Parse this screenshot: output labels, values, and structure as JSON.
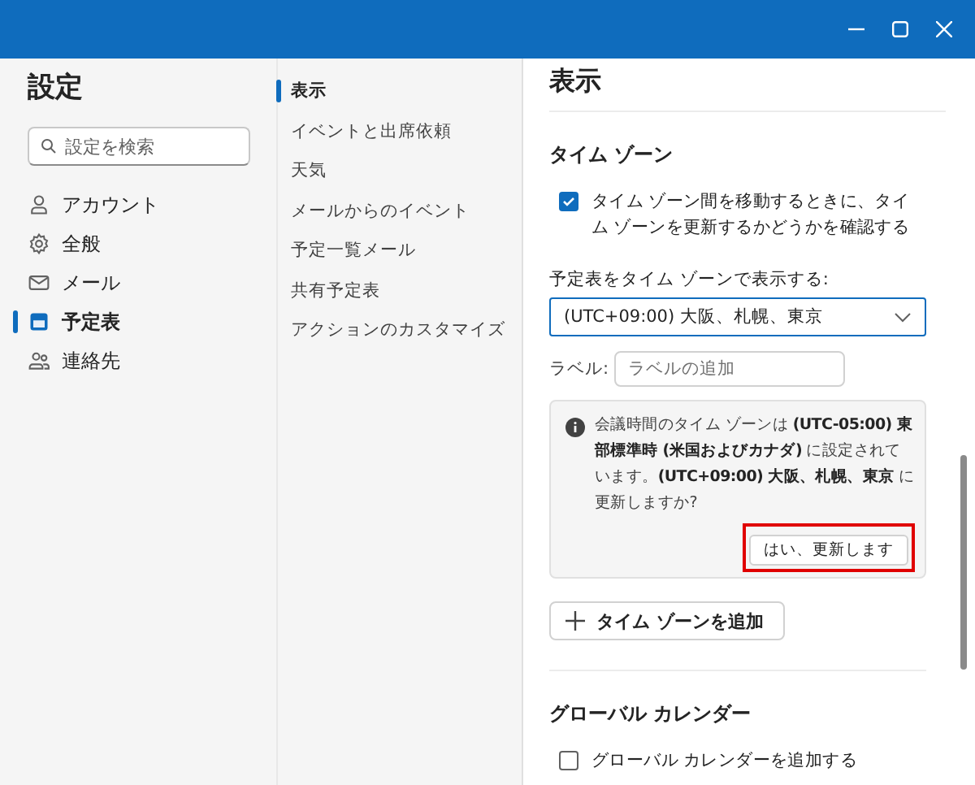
{
  "settings_nav": {
    "title": "設定",
    "search": {
      "placeholder": "設定を検索"
    },
    "items": [
      {
        "label": "アカウント",
        "kind": "person",
        "selected": false
      },
      {
        "label": "全般",
        "kind": "gear",
        "selected": false
      },
      {
        "label": "メール",
        "kind": "mail",
        "selected": false
      },
      {
        "label": "予定表",
        "kind": "calendar",
        "selected": true
      },
      {
        "label": "連絡先",
        "kind": "people",
        "selected": false
      }
    ]
  },
  "sub_nav": {
    "items": [
      {
        "label": "表示",
        "selected": true
      },
      {
        "label": "イベントと出席依頼",
        "selected": false
      },
      {
        "label": "天気",
        "selected": false
      },
      {
        "label": "メールからのイベント",
        "selected": false
      },
      {
        "label": "予定一覧メール",
        "selected": false
      },
      {
        "label": "共有予定表",
        "selected": false
      },
      {
        "label": "アクションのカスタマイズ",
        "selected": false
      }
    ]
  },
  "content": {
    "title": "表示",
    "time_zone": {
      "heading": "タイム ゾーン",
      "confirm_checkbox": {
        "label": "タイム ゾーン間を移動するときに、タイム ゾーンを更新するかどうかを確認する",
        "checked": true
      },
      "display_select": {
        "label": "予定表をタイム ゾーンで表示する:",
        "value": "(UTC+09:00) 大阪、札幌、東京"
      },
      "label_field": {
        "label": "ラベル:",
        "placeholder": "ラベルの追加"
      },
      "notice": {
        "text": "会議時間のタイム ゾーンは **(UTC-05:00) 東部標準時 (米国およびカナダ)** に設定されています。**(UTC+09:00) 大阪、札幌、東京** に更新しますか?",
        "button": "はい、更新します",
        "highlighted": true
      },
      "add_button": "タイム ゾーンを追加"
    },
    "global_calendar": {
      "heading": "グローバル カレンダー",
      "checkbox": {
        "label": "グローバル カレンダーを追加する",
        "checked": false
      }
    }
  }
}
